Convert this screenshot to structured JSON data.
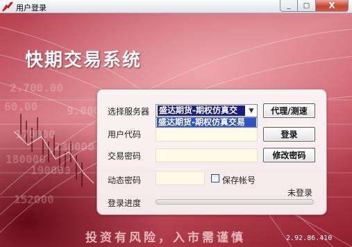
{
  "window": {
    "title": "用户登录",
    "controls": {
      "minimize": "_",
      "maximize": "□",
      "close": "X"
    }
  },
  "app": {
    "title": "快期交易系统",
    "slogan": "投资有风险，入市需谨慎",
    "version": "2.92.86.410"
  },
  "background_numbers": [
    "2.700.00",
    "60.00",
    "9.000",
    "170000",
    "230000",
    "180000",
    "190000",
    "152000"
  ],
  "form": {
    "server_label": "选择服务器",
    "server_selected": "盛达期货-期权仿真交",
    "server_options": [
      "盛达期货-期权仿真交易"
    ],
    "user_code_label": "用户代码",
    "user_code_value": "",
    "password_label": "交易密码",
    "password_value": "",
    "dynamic_password_label": "动态密码",
    "dynamic_password_value": "",
    "save_account_label": "保存帐号",
    "save_account_checked": false,
    "status": "未登录",
    "progress_label": "登录进度",
    "progress": 0
  },
  "buttons": {
    "proxy": "代理/测速",
    "login": "登录",
    "change_password": "修改密码"
  },
  "colors": {
    "accent": "#c8452f",
    "selection": "#1b1e80",
    "field_bg": "#fffbe6",
    "panel_bg": "#fbf3f3"
  }
}
